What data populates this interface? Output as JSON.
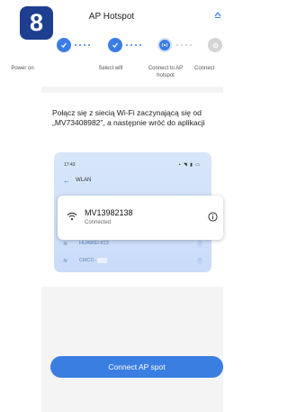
{
  "badge": "8",
  "header": {
    "title": "AP Hotspot"
  },
  "steps": [
    {
      "label": "Power on",
      "state": "done"
    },
    {
      "label": "Select wifi",
      "state": "done"
    },
    {
      "label": "Connect to AP hotspot",
      "state": "active"
    },
    {
      "label": "Connect",
      "state": "pending"
    }
  ],
  "instruction": "Połącz się z siecią Wi-Fi zaczynającą się od „MV73408982”, a następnie wróć do aplikacji",
  "phone": {
    "time": "17:43",
    "screen_title": "WLAN",
    "connected": {
      "ssid": "MV13982138",
      "status": "Connected"
    },
    "other_networks": [
      "HUAWEI-813",
      "CMCC-"
    ]
  },
  "primary_button": "Connect AP spot",
  "colors": {
    "accent": "#3a7ee2",
    "badge": "#1e3f8f",
    "phone_bg": "#d8e6fb"
  }
}
